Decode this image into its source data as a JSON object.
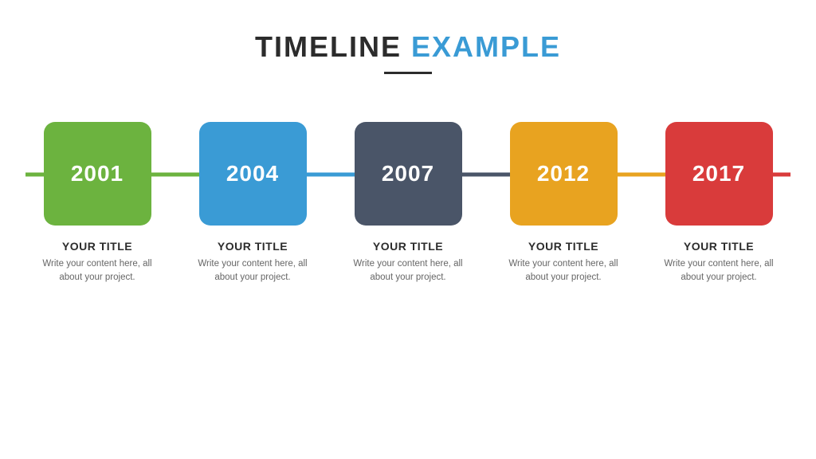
{
  "header": {
    "title_part1": "TIMELINE",
    "title_part2": "EXAMPLE",
    "divider": true
  },
  "timeline": {
    "items": [
      {
        "year": "2001",
        "color": "green",
        "hex": "#6cb33f",
        "title": "YOUR TITLE",
        "description": "Write your content here, all about your project."
      },
      {
        "year": "2004",
        "color": "blue",
        "hex": "#3a9bd5",
        "title": "YOUR TITLE",
        "description": "Write your content here, all about your project."
      },
      {
        "year": "2007",
        "color": "slate",
        "hex": "#4a5568",
        "title": "YOUR TITLE",
        "description": "Write your content here, all about your project."
      },
      {
        "year": "2012",
        "color": "orange",
        "hex": "#e8a320",
        "title": "YOUR TITLE",
        "description": "Write your content here, all about your project."
      },
      {
        "year": "2017",
        "color": "red",
        "hex": "#d93b3b",
        "title": "YOUR TITLE",
        "description": "Write your content here, all about your project."
      }
    ]
  }
}
